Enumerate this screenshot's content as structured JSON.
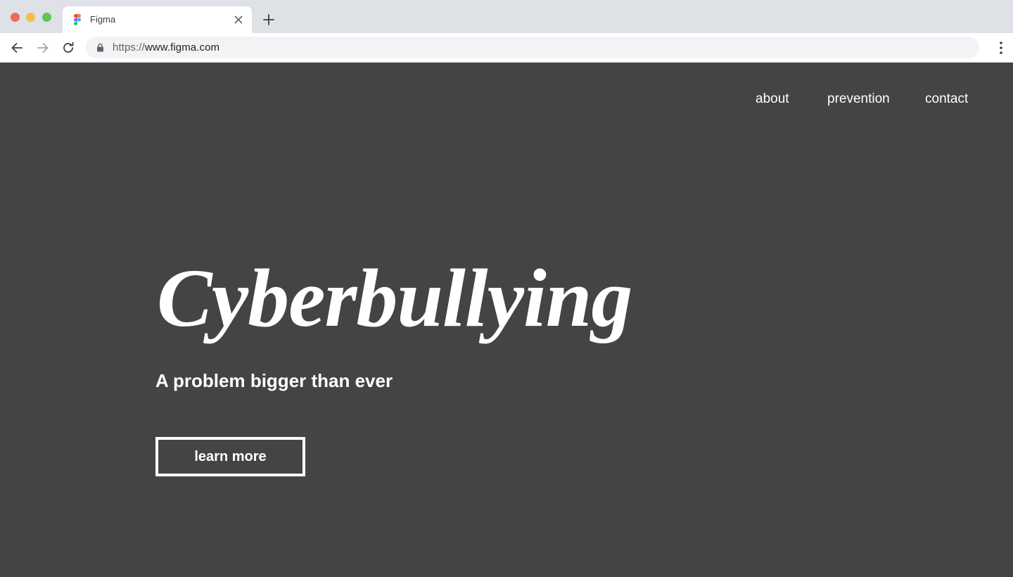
{
  "browser": {
    "tab_title": "Figma",
    "url_scheme": "https://",
    "url_host": "www.figma.com",
    "icons": [
      "figma-favicon-icon",
      "close-icon",
      "plus-icon",
      "back-arrow-icon",
      "forward-arrow-icon",
      "reload-icon",
      "lock-icon",
      "kebab-menu-icon"
    ]
  },
  "site": {
    "nav": {
      "about": "about",
      "prevention": "prevention",
      "contact": "contact"
    },
    "hero": {
      "title": "Cyberbullying",
      "subtitle": "A problem bigger than ever",
      "cta_label": "learn more"
    }
  },
  "colors": {
    "page_background": "#444444",
    "text": "#ffffff",
    "chrome_background": "#dee1e6"
  }
}
